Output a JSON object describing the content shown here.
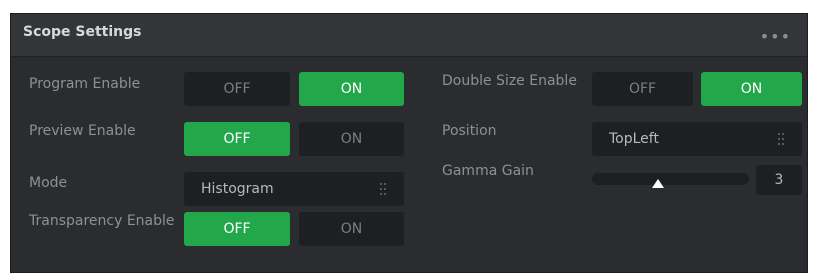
{
  "panel": {
    "title": "Scope Settings",
    "more_icon": "•••"
  },
  "program_enable": {
    "label": "Program Enable",
    "off": "OFF",
    "on": "ON",
    "selected": "ON"
  },
  "preview_enable": {
    "label": "Preview Enable",
    "off": "OFF",
    "on": "ON",
    "selected": "OFF"
  },
  "mode": {
    "label": "Mode",
    "value": "Histogram",
    "icon": "grip-dots-icon"
  },
  "transparency_enable": {
    "label": "Transparency Enable",
    "off": "OFF",
    "on": "ON",
    "selected": "OFF"
  },
  "double_size_enable": {
    "label": "Double Size Enable",
    "off": "OFF",
    "on": "ON",
    "selected": "ON"
  },
  "position": {
    "label": "Position",
    "value": "TopLeft",
    "icon": "grip-dots-icon"
  },
  "gamma_gain": {
    "label": "Gamma Gain",
    "value": "3",
    "slider_fraction": 0.42
  },
  "colors": {
    "accent": "#22a84a",
    "panel": "#2a2c2f",
    "field": "#1e1f22"
  }
}
